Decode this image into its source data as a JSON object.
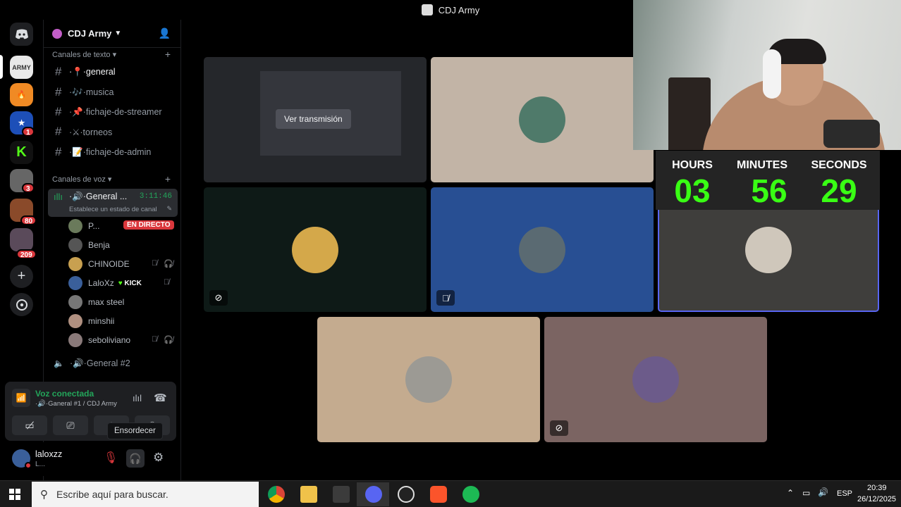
{
  "window": {
    "title": "CDJ Army"
  },
  "rail": {
    "badges": [
      "1",
      "3",
      "80",
      "209"
    ],
    "add_label": "+"
  },
  "guild": {
    "name": "CDJ Army"
  },
  "text_category": "Canales de texto",
  "text_channels": [
    {
      "label": "·📍·general"
    },
    {
      "label": "·🎶·musica"
    },
    {
      "label": "·📌·fichaje-de-streamer"
    },
    {
      "label": "·⚔·torneos"
    },
    {
      "label": "·📝·fichaje-de-admin"
    }
  ],
  "voice_category": "Canales de voz",
  "voice_channel": {
    "name": "·🔊·General ...",
    "duration": "3:11:46",
    "status": "Establece un estado de canal"
  },
  "voice_users": [
    {
      "name": "P...",
      "live": "EN DIRECTO",
      "color": "#6a7a5b"
    },
    {
      "name": "Benja",
      "color": "#555"
    },
    {
      "name": "CHINOIDE",
      "color": "#c8a050"
    },
    {
      "name": "LaloXz",
      "tag": "KICK",
      "color": "#3a5f9a"
    },
    {
      "name": "max steel",
      "color": "#777"
    },
    {
      "name": "minshii",
      "color": "#b09080"
    },
    {
      "name": "seboliviano",
      "color": "#8a7a7a"
    }
  ],
  "voice_channel_2": {
    "name": "·🔊·General #2"
  },
  "voice_panel": {
    "status": "Voz conectada",
    "location": "·🔊·Ganeral #1 / CDJ Army"
  },
  "tooltip": "Ensordecer",
  "user_panel": {
    "username": "laloxzz",
    "status": "L..."
  },
  "stream": {
    "watch_label": "Ver transmisión"
  },
  "timer": {
    "labels": {
      "hours": "HOURS",
      "minutes": "MINUTES",
      "seconds": "SECONDS"
    },
    "hours": "03",
    "minutes": "56",
    "seconds": "29"
  },
  "taskbar": {
    "search_placeholder": "Escribe aquí para buscar.",
    "lang": "ESP",
    "time": "20:39",
    "date": "26/12/2025"
  },
  "colors": {
    "live_red": "#da373c",
    "kick_green": "#53fc18",
    "voice_green": "#23a55a",
    "timer_green": "#39ff14",
    "highlight_tile": "#5865f2"
  }
}
